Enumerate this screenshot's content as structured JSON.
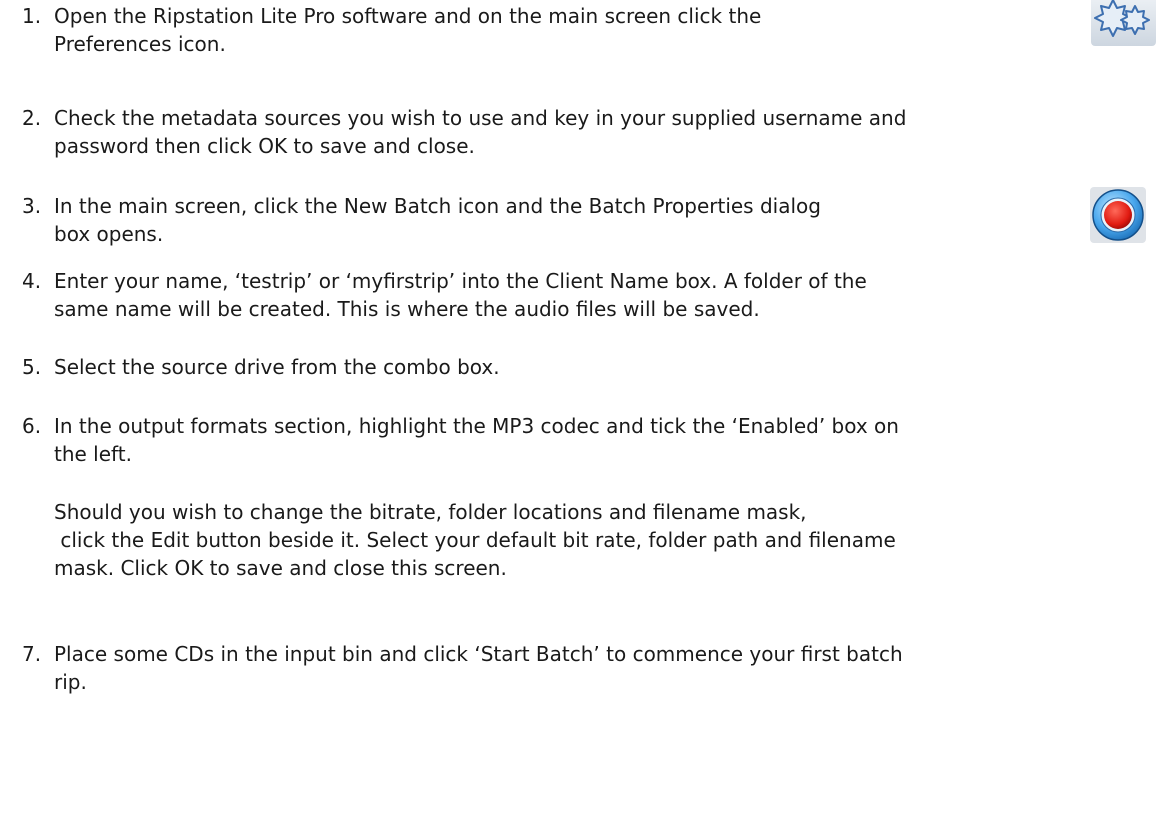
{
  "steps": [
    {
      "number": "1.",
      "lines": [
        "Open the Ripstation Lite Pro software and on the main screen click the",
        "Preferences icon."
      ],
      "icon": "preferences-gears-icon"
    },
    {
      "number": "2.",
      "lines": [
        "Check the metadata sources you wish to use and key in your supplied username and",
        "password then click OK to save and close."
      ]
    },
    {
      "number": "3.",
      "lines": [
        "In the main screen, click the New Batch icon and the Batch Properties dialog",
        "box opens."
      ],
      "icon": "new-batch-record-icon"
    },
    {
      "number": "4.",
      "lines": [
        "Enter your name, ‘testrip’ or ‘myfirstrip’ into the Client Name box.  A folder of the",
        "same name will be created.  This is where the audio files will be saved."
      ]
    },
    {
      "number": "5.",
      "lines": [
        "Select the source drive from the combo box."
      ]
    },
    {
      "number": "6.",
      "lines": [
        "In the output formats section, highlight the MP3 codec and tick the ‘Enabled’ box on",
        "the left."
      ],
      "extra_lines": [
        "Should you wish to change the bitrate, folder locations and filename mask,",
        " click the Edit button beside it. Select your default bit rate, folder path and filename",
        "mask. Click OK to save and close this screen."
      ]
    },
    {
      "number": "7.",
      "lines": [
        "Place some CDs in the input bin and click ‘Start Batch’ to commence your first batch",
        "rip."
      ]
    }
  ]
}
